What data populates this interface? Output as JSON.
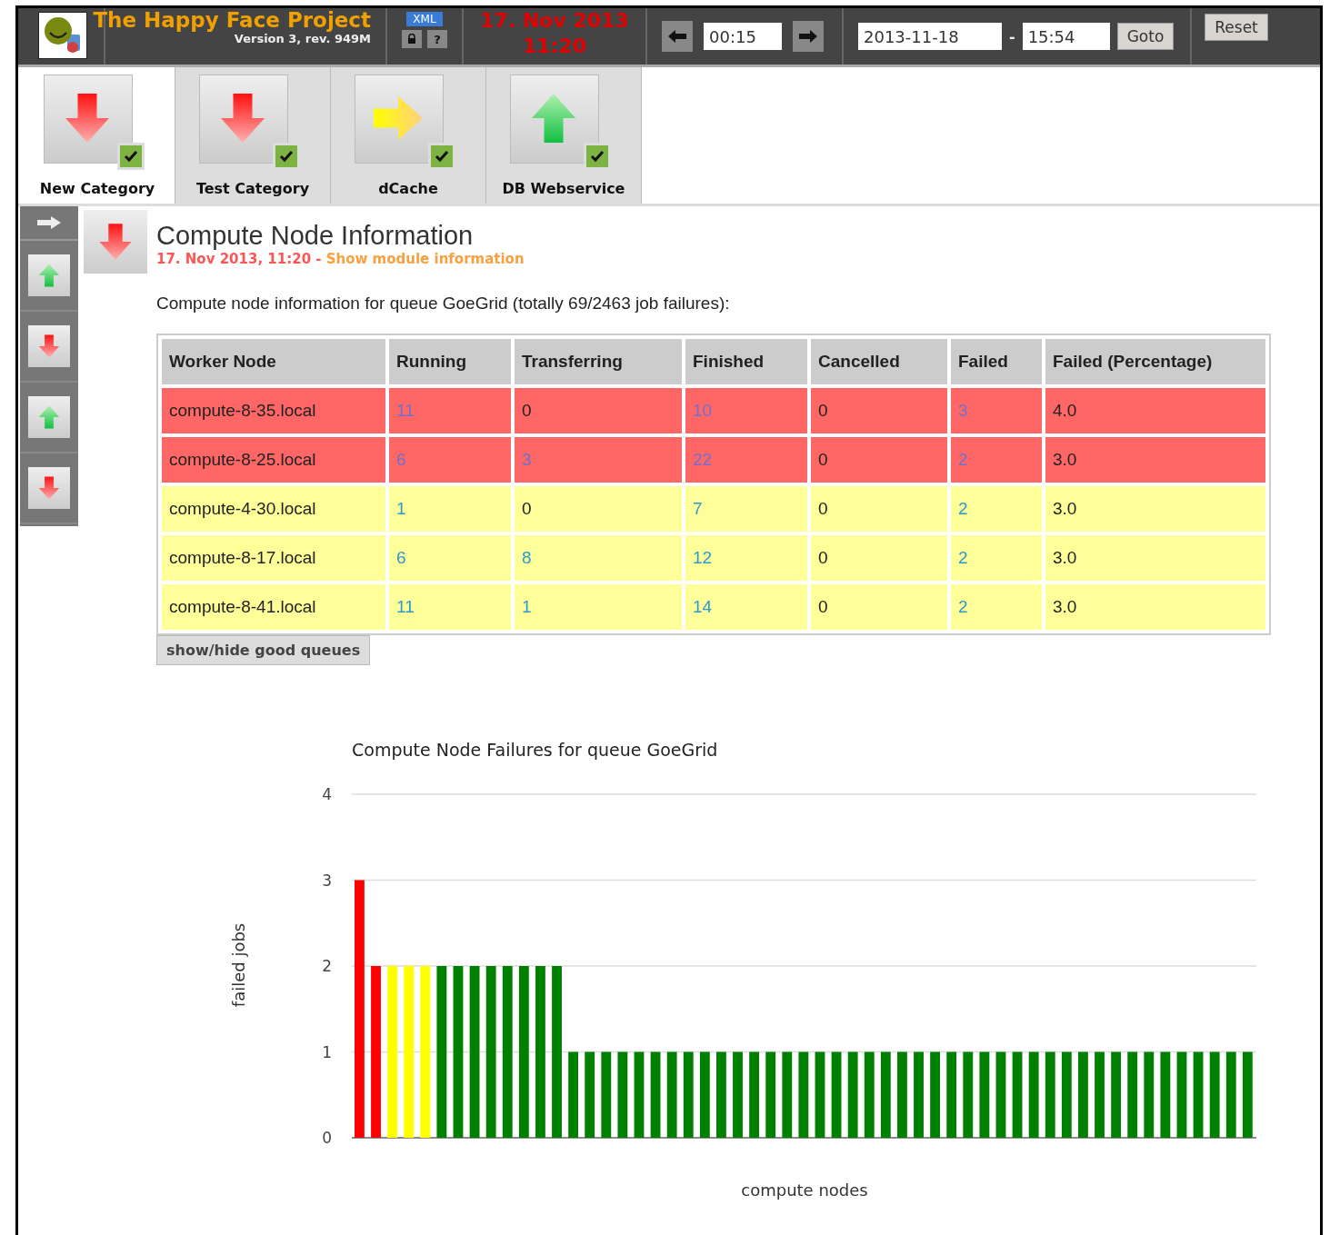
{
  "header": {
    "title": "The Happy Face Project",
    "version": "Version 3, rev. 949M",
    "xml_button": "XML",
    "help_button": "?",
    "date": "17. Nov 2013",
    "time": "11:20",
    "interval": "00:15",
    "goto_date": "2013-11-18",
    "separator": "-",
    "goto_time": "15:54",
    "goto_button": "Goto",
    "reset_button": "Reset"
  },
  "categories": [
    {
      "label": "New Category",
      "kind": "down",
      "selected": true
    },
    {
      "label": "Test Category",
      "kind": "down",
      "selected": false
    },
    {
      "label": "dCache",
      "kind": "right",
      "selected": false
    },
    {
      "label": "DB Webservice",
      "kind": "up",
      "selected": false
    }
  ],
  "sidebar": {
    "items": [
      {
        "kind": "up"
      },
      {
        "kind": "down"
      },
      {
        "kind": "up"
      },
      {
        "kind": "down"
      }
    ]
  },
  "module": {
    "kind": "down",
    "title": "Compute Node Information",
    "timestamp": "17. Nov 2013, 11:20",
    "separator": " - ",
    "info_link": "Show module information",
    "description": "Compute node information for queue GoeGrid (totally 69/2463 job failures):",
    "table": {
      "columns": [
        "Worker Node",
        "Running",
        "Transferring",
        "Finished",
        "Cancelled",
        "Failed",
        "Failed (Percentage)"
      ],
      "rows": [
        {
          "color": "#ff6666",
          "cells": [
            {
              "text": "compute-8-35.local",
              "link": false
            },
            {
              "text": "11",
              "link": true
            },
            {
              "text": "0",
              "link": false
            },
            {
              "text": "10",
              "link": true
            },
            {
              "text": "0",
              "link": false
            },
            {
              "text": "3",
              "link": true
            },
            {
              "text": "4.0",
              "link": false
            }
          ]
        },
        {
          "color": "#ff6666",
          "cells": [
            {
              "text": "compute-8-25.local",
              "link": false
            },
            {
              "text": "6",
              "link": true
            },
            {
              "text": "3",
              "link": true
            },
            {
              "text": "22",
              "link": true
            },
            {
              "text": "0",
              "link": false
            },
            {
              "text": "2",
              "link": true
            },
            {
              "text": "3.0",
              "link": false
            }
          ]
        },
        {
          "color": "#ffff99",
          "cells": [
            {
              "text": "compute-4-30.local",
              "link": false
            },
            {
              "text": "1",
              "link": true
            },
            {
              "text": "0",
              "link": false
            },
            {
              "text": "7",
              "link": true
            },
            {
              "text": "0",
              "link": false
            },
            {
              "text": "2",
              "link": true
            },
            {
              "text": "3.0",
              "link": false
            }
          ]
        },
        {
          "color": "#ffff99",
          "cells": [
            {
              "text": "compute-8-17.local",
              "link": false
            },
            {
              "text": "6",
              "link": true
            },
            {
              "text": "8",
              "link": true
            },
            {
              "text": "12",
              "link": true
            },
            {
              "text": "0",
              "link": false
            },
            {
              "text": "2",
              "link": true
            },
            {
              "text": "3.0",
              "link": false
            }
          ]
        },
        {
          "color": "#ffff99",
          "cells": [
            {
              "text": "compute-8-41.local",
              "link": false
            },
            {
              "text": "11",
              "link": true
            },
            {
              "text": "1",
              "link": true
            },
            {
              "text": "14",
              "link": true
            },
            {
              "text": "0",
              "link": false
            },
            {
              "text": "2",
              "link": true
            },
            {
              "text": "3.0",
              "link": false
            }
          ]
        }
      ]
    },
    "toggle_button": "show/hide good queues",
    "chart_data": {
      "type": "bar",
      "title": "Compute Node Failures for queue GoeGrid",
      "xlabel": "compute nodes",
      "ylabel": "failed jobs",
      "ylim": [
        0,
        4
      ],
      "yticks": [
        0,
        1,
        2,
        3,
        4
      ],
      "stacked": true,
      "grid": true,
      "series": [
        {
          "color": "#ff0000",
          "values": [
            3,
            2,
            null,
            null,
            null,
            null,
            null,
            null,
            null,
            null,
            null,
            null,
            null,
            null,
            null,
            null,
            null,
            null,
            null,
            null,
            null,
            null,
            null,
            null,
            null,
            null,
            null,
            null,
            null,
            null,
            null,
            null,
            null,
            null,
            null,
            null,
            null,
            null,
            null,
            null,
            null,
            null,
            null,
            null,
            null,
            null,
            null,
            null,
            null,
            null,
            null,
            null,
            null,
            null,
            null
          ]
        },
        {
          "color": "#ffff00",
          "values": [
            null,
            null,
            2,
            2,
            2,
            null,
            null,
            null,
            null,
            null,
            null,
            null,
            null,
            null,
            null,
            null,
            null,
            null,
            null,
            null,
            null,
            null,
            null,
            null,
            null,
            null,
            null,
            null,
            null,
            null,
            null,
            null,
            null,
            null,
            null,
            null,
            null,
            null,
            null,
            null,
            null,
            null,
            null,
            null,
            null,
            null,
            null,
            null,
            null,
            null,
            null,
            null,
            null,
            null,
            null
          ]
        },
        {
          "color": "#008000",
          "values": [
            null,
            null,
            null,
            null,
            null,
            2,
            2,
            2,
            2,
            2,
            2,
            2,
            2,
            1,
            1,
            1,
            1,
            1,
            1,
            1,
            1,
            1,
            1,
            1,
            1,
            1,
            1,
            1,
            1,
            1,
            1,
            1,
            1,
            1,
            1,
            1,
            1,
            1,
            1,
            1,
            1,
            1,
            1,
            1,
            1,
            1,
            1,
            1,
            1,
            1,
            1,
            1,
            1,
            1,
            1
          ]
        }
      ]
    }
  }
}
